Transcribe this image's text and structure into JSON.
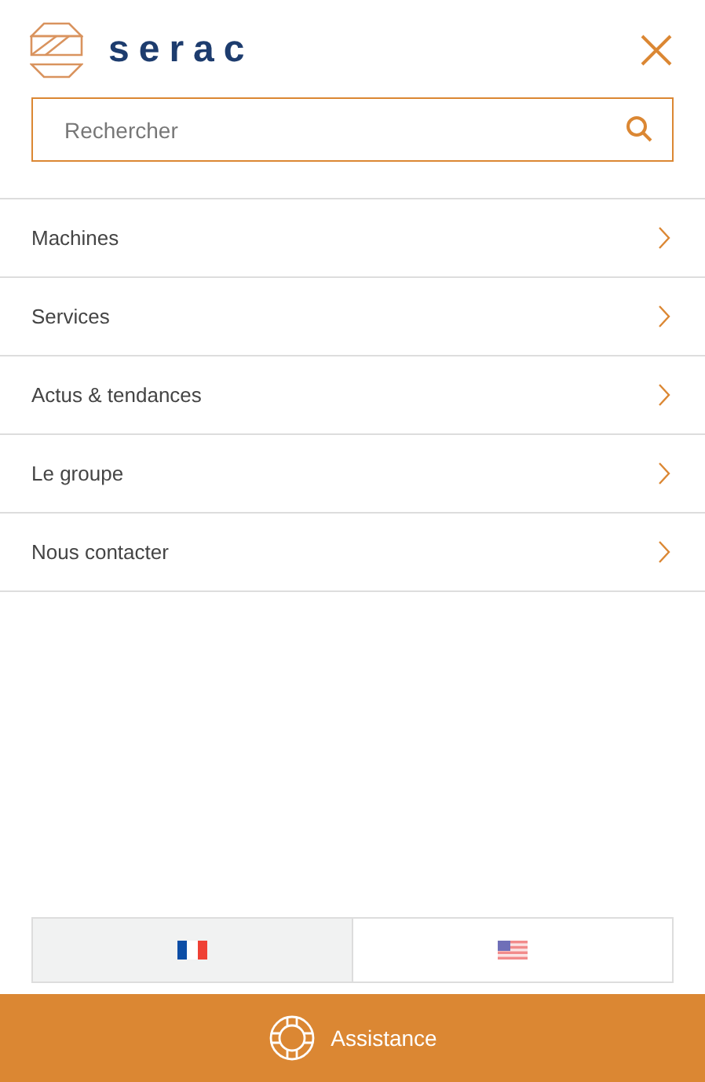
{
  "logo": {
    "text": "serac"
  },
  "search": {
    "placeholder": "Rechercher"
  },
  "menu": [
    {
      "label": "Machines"
    },
    {
      "label": "Services"
    },
    {
      "label": "Actus & tendances"
    },
    {
      "label": "Le groupe"
    },
    {
      "label": "Nous contacter"
    }
  ],
  "languages": [
    {
      "kind": "fr",
      "selected": true
    },
    {
      "kind": "us",
      "selected": false
    }
  ],
  "footer": {
    "label": "Assistance"
  }
}
